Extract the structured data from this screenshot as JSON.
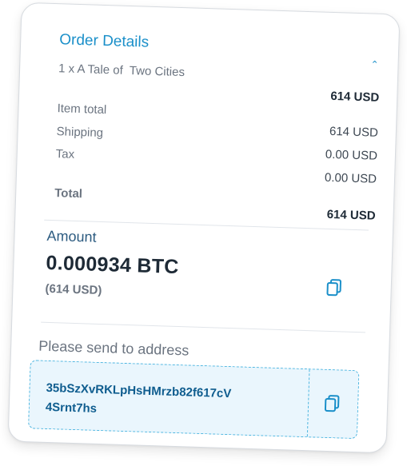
{
  "order": {
    "title": "Order Details",
    "item_line": "1 x A Tale of  Two Cities",
    "item_price": "614 USD",
    "rows": [
      {
        "label": "Item total",
        "value": "614 USD"
      },
      {
        "label": "Shipping",
        "value": "0.00 USD"
      },
      {
        "label": "Tax",
        "value": "0.00 USD"
      }
    ],
    "total_label": "Total",
    "total_value": "614 USD",
    "collapse_icon": "chevron-up-icon"
  },
  "amount": {
    "label": "Amount",
    "btc": "0.000934 BTC",
    "usd": "(614 USD)",
    "copy_icon": "copy-icon"
  },
  "send": {
    "label": "Please send to address",
    "address_line1": "35bSzXvRKLpHsHMrzb82f617cV",
    "address_line2": "4Srnt7hs",
    "copy_icon": "copy-icon"
  },
  "colors": {
    "accent": "#1a8fc9",
    "address_text": "#0f5d8f",
    "address_bg": "#eaf6fd",
    "dashed_border": "#4fb6e0"
  }
}
